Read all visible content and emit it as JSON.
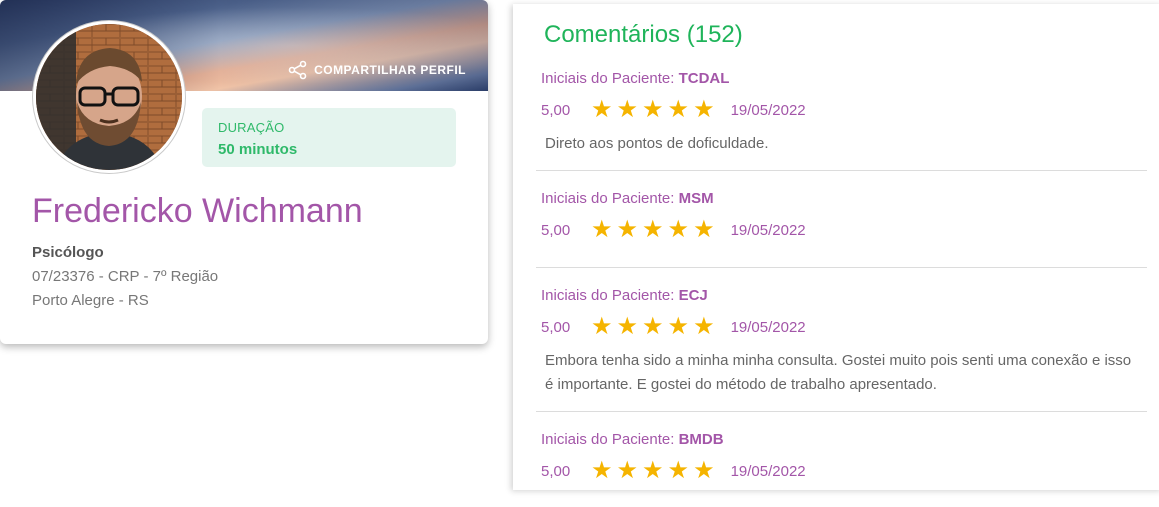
{
  "profile": {
    "share_label": "COMPARTILHAR PERFIL",
    "duration_label": "DURAÇÃO",
    "duration_value": "50 minutos",
    "name": "Fredericko Wichmann",
    "profession": "Psicólogo",
    "register": "07/23376 - CRP - 7º Região",
    "location": "Porto Alegre - RS"
  },
  "comments": {
    "title": "Comentários (152)",
    "initials_prefix": "Iniciais do Paciente: ",
    "items": [
      {
        "initials": "TCDAL",
        "score": "5,00",
        "stars": 5,
        "date": "19/05/2022",
        "text": "Direto aos pontos de doficuldade."
      },
      {
        "initials": "MSM",
        "score": "5,00",
        "stars": 5,
        "date": "19/05/2022",
        "text": ""
      },
      {
        "initials": "ECJ",
        "score": "5,00",
        "stars": 5,
        "date": "19/05/2022",
        "text": "Embora tenha sido a minha minha consulta. Gostei muito pois senti uma conexão e isso é importante. E gostei do método de trabalho apresentado."
      },
      {
        "initials": "BMDB",
        "score": "5,00",
        "stars": 5,
        "date": "19/05/2022",
        "text": ""
      }
    ]
  },
  "colors": {
    "accent_purple": "#a356a8",
    "accent_green": "#1fb45a",
    "star": "#f5b400"
  }
}
